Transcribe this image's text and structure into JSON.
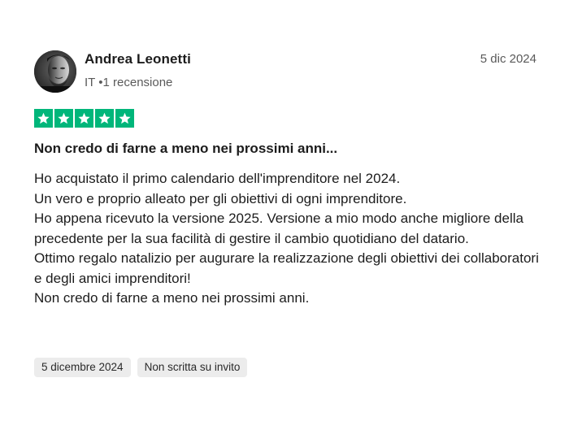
{
  "reviewer": {
    "name": "Andrea Leonetti",
    "country": "IT",
    "separator": "•",
    "review_count": "1 recensione"
  },
  "review": {
    "date_short": "5 dic 2024",
    "rating": 5,
    "rating_max": 5,
    "title": "Non credo di farne a meno nei prossimi anni...",
    "body": [
      "Ho acquistato il primo calendario dell'imprenditore nel 2024.",
      "Un vero e proprio alleato per gli obiettivi di ogni imprenditore.",
      "Ho appena ricevuto la versione 2025. Versione a mio modo anche migliore della precedente per la sua facilità di gestire il cambio quotidiano del datario.",
      "Ottimo regalo natalizio per augurare la realizzazione degli obiettivi dei collaboratori e degli amici imprenditori!",
      "Non credo di farne a meno nei prossimi anni."
    ],
    "experience_date": "5 dicembre 2024",
    "invite_status": "Non scritta su invito"
  },
  "colors": {
    "star_green": "#00b67a",
    "tag_bg": "#ececec",
    "meta_text": "#5a5a5a"
  },
  "icons": {
    "star": "star-icon",
    "avatar": "avatar-photo"
  }
}
